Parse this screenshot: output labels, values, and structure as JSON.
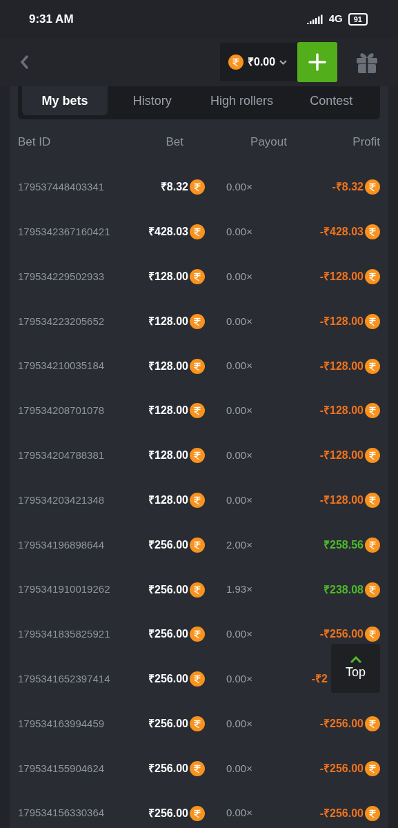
{
  "status_bar": {
    "time": "9:31 AM",
    "network": "4G",
    "battery": "91"
  },
  "header": {
    "balance": "₹0.00"
  },
  "tabs": [
    {
      "label": "My bets",
      "selected": true
    },
    {
      "label": "History",
      "selected": false
    },
    {
      "label": "High rollers",
      "selected": false
    },
    {
      "label": "Contest",
      "selected": false
    }
  ],
  "table": {
    "columns": [
      "Bet ID",
      "Bet",
      "Payout",
      "Profit"
    ],
    "rows": [
      {
        "bet_id": "179537448403341",
        "bet": "₹8.32",
        "payout": "0.00×",
        "profit": "-₹8.32",
        "kind": "loss"
      },
      {
        "bet_id": "1795342367160421",
        "bet": "₹428.03",
        "payout": "0.00×",
        "profit": "-₹428.03",
        "kind": "loss"
      },
      {
        "bet_id": "179534229502933",
        "bet": "₹128.00",
        "payout": "0.00×",
        "profit": "-₹128.00",
        "kind": "loss"
      },
      {
        "bet_id": "179534223205652",
        "bet": "₹128.00",
        "payout": "0.00×",
        "profit": "-₹128.00",
        "kind": "loss"
      },
      {
        "bet_id": "179534210035184",
        "bet": "₹128.00",
        "payout": "0.00×",
        "profit": "-₹128.00",
        "kind": "loss"
      },
      {
        "bet_id": "179534208701078",
        "bet": "₹128.00",
        "payout": "0.00×",
        "profit": "-₹128.00",
        "kind": "loss"
      },
      {
        "bet_id": "179534204788381",
        "bet": "₹128.00",
        "payout": "0.00×",
        "profit": "-₹128.00",
        "kind": "loss"
      },
      {
        "bet_id": "179534203421348",
        "bet": "₹128.00",
        "payout": "0.00×",
        "profit": "-₹128.00",
        "kind": "loss"
      },
      {
        "bet_id": "179534196898644",
        "bet": "₹256.00",
        "payout": "2.00×",
        "profit": "₹258.56",
        "kind": "win"
      },
      {
        "bet_id": "1795341910019262",
        "bet": "₹256.00",
        "payout": "1.93×",
        "profit": "₹238.08",
        "kind": "win"
      },
      {
        "bet_id": "1795341835825921",
        "bet": "₹256.00",
        "payout": "0.00×",
        "profit": "-₹256.00",
        "kind": "loss"
      },
      {
        "bet_id": "1795341652397414",
        "bet": "₹256.00",
        "payout": "0.00×",
        "profit": "-₹2",
        "kind": "loss",
        "covered": true
      },
      {
        "bet_id": "179534163994459",
        "bet": "₹256.00",
        "payout": "0.00×",
        "profit": "-₹256.00",
        "kind": "loss"
      },
      {
        "bet_id": "179534155904624",
        "bet": "₹256.00",
        "payout": "0.00×",
        "profit": "-₹256.00",
        "kind": "loss"
      },
      {
        "bet_id": "179534156330364",
        "bet": "₹256.00",
        "payout": "0.00×",
        "profit": "-₹256.00",
        "kind": "loss"
      }
    ]
  },
  "top_button": {
    "label": "Top"
  }
}
